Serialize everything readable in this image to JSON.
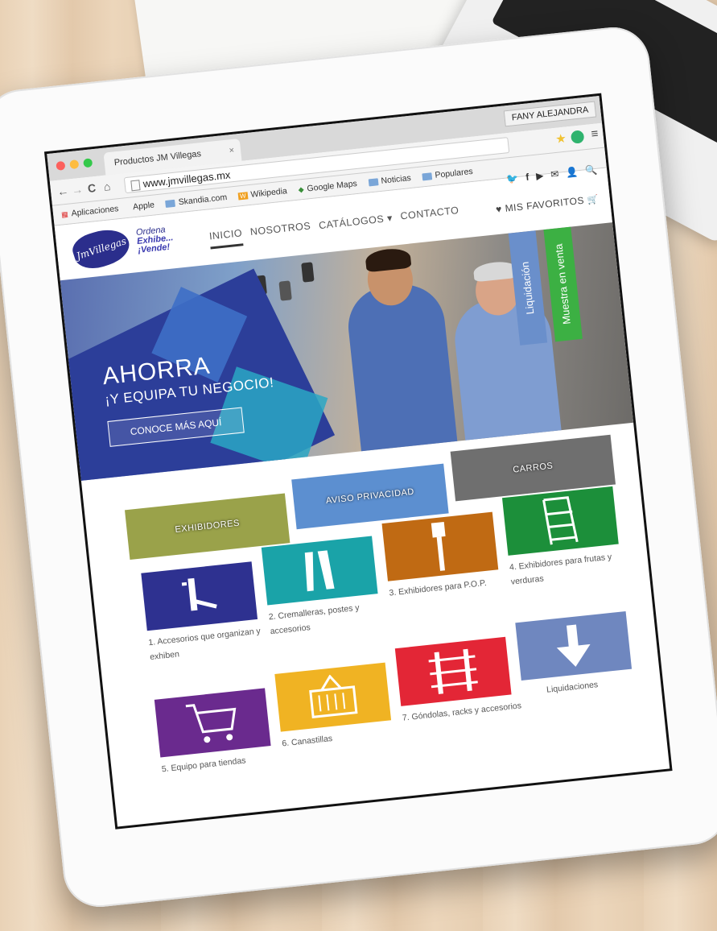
{
  "browser": {
    "tab_title": "Productos JM Villegas",
    "tab_close": "×",
    "user_badge": "FANY ALEJANDRA",
    "url": "www.jmvillegas.mx",
    "back": "←",
    "forward": "→",
    "reload": "C",
    "home": "⌂",
    "star": "★",
    "menu": "≡",
    "bookmarks": [
      {
        "label": "Aplicaciones",
        "icon": "apps-icon"
      },
      {
        "label": "Apple",
        "icon": "apple-icon"
      },
      {
        "label": "Skandia.com",
        "icon": "folder-icon"
      },
      {
        "label": "Wikipedia",
        "icon": "wikipedia-icon"
      },
      {
        "label": "Google Maps",
        "icon": "maps-icon"
      },
      {
        "label": "Noticias",
        "icon": "folder-icon"
      },
      {
        "label": "Populares",
        "icon": "folder-icon"
      }
    ]
  },
  "site": {
    "logo_text": "JmVillegas",
    "tagline": [
      "Ordena",
      "Exhibe...",
      "¡Vende!"
    ],
    "nav": [
      "INICIO",
      "NOSOTROS",
      "CATÁLOGOS",
      "CONTACTO"
    ],
    "nav_caret": "▾",
    "favorites": "MIS FAVORITOS",
    "social_icons": [
      "twitter-icon",
      "facebook-icon",
      "youtube-icon",
      "mail-icon",
      "user-icon",
      "search-icon"
    ],
    "social_glyphs": [
      "🐦",
      "f",
      "▶",
      "✉",
      "👤",
      "🔍"
    ],
    "heart": "♥",
    "cart": "🛒"
  },
  "hero": {
    "title": "AHORRA",
    "subtitle": "¡Y EQUIPA TU NEGOCIO!",
    "button": "CONOCE MÁS AQUÍ",
    "ribbons": [
      {
        "label": "Liquidación",
        "color": "#6a8fcb"
      },
      {
        "label": "Muestra en venta",
        "color": "#3cb043"
      }
    ]
  },
  "thumbs": [
    {
      "label": "EXHIBIDORES",
      "color": "#9aa24a"
    },
    {
      "label": "AVISO PRIVACIDAD",
      "color": "#5c8fd0"
    },
    {
      "label": "CARROS",
      "color": "#6f6f6f"
    }
  ],
  "categories": [
    {
      "label": "1. Accesorios que organizan y exhiben",
      "color": "#2e3190",
      "icon": "hook-icon"
    },
    {
      "label": "2. Cremalleras, postes y accesorios",
      "color": "#1aa3a8",
      "icon": "rack-icon"
    },
    {
      "label": "3. Exhibidores para P.O.P.",
      "color": "#c06a13",
      "icon": "pop-icon"
    },
    {
      "label": "4. Exhibidores para frutas y verduras",
      "color": "#1c8f3a",
      "icon": "produce-stand-icon"
    },
    {
      "label": "5. Equipo para tiendas",
      "color": "#6a2a8e",
      "icon": "cart-icon"
    },
    {
      "label": "6. Canastillas",
      "color": "#f0b323",
      "icon": "basket-icon"
    },
    {
      "label": "7. Góndolas, racks y accesorios",
      "color": "#e32636",
      "icon": "gondola-icon"
    },
    {
      "label": "Liquidaciones",
      "color": "#6f87bf",
      "icon": "down-arrow-icon"
    }
  ]
}
